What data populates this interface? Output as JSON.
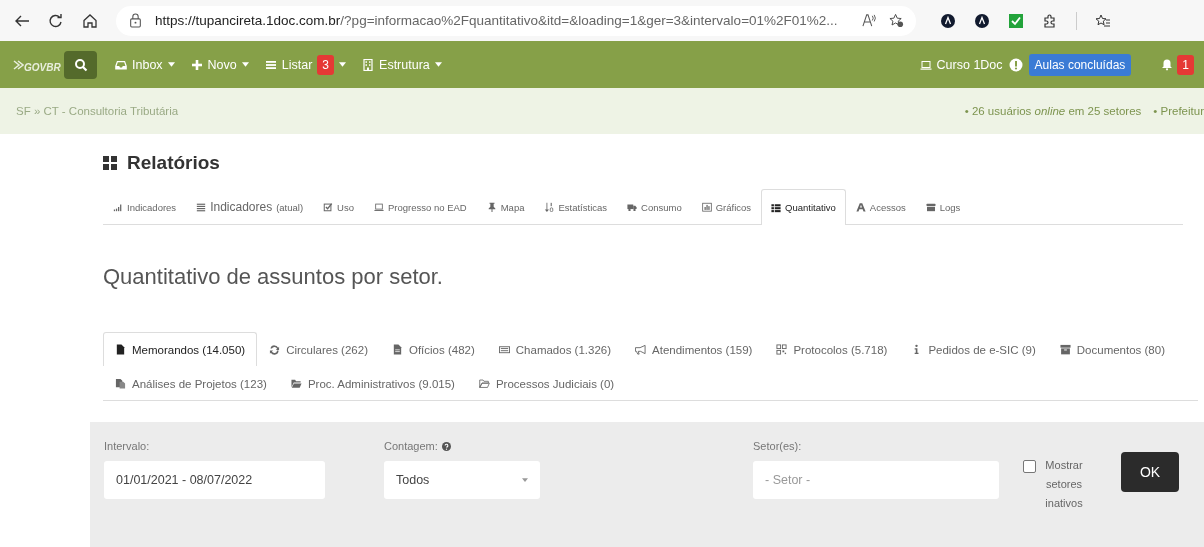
{
  "browser": {
    "url_host": "https://tupancireta.1doc.com.br",
    "url_rest": "/?pg=informacao%2Fquantitativo&itd=&loading=1&ger=3&intervalo=01%2F01%2..."
  },
  "navbar": {
    "logo": "GOVBR",
    "menu": [
      {
        "label": "Inbox"
      },
      {
        "label": "Novo"
      },
      {
        "label": "Listar",
        "badge": "3"
      },
      {
        "label": "Estrutura"
      }
    ],
    "course": "Curso 1Doc",
    "course_badge": "Aulas concluídas",
    "notifications": "1"
  },
  "breadcrumb": {
    "path": "SF » CT - Consultoria Tributária",
    "online": "• 26 usuários *online* em 25 setores",
    "org": "• Prefeitur"
  },
  "page_title": "Relatórios",
  "report_tabs": [
    {
      "label": "Indicadores",
      "selected": false
    },
    {
      "label": "Indicadores",
      "suffix": "(atual)",
      "selected": false
    },
    {
      "label": "Uso",
      "selected": false
    },
    {
      "label": "Progresso no EAD",
      "selected": false
    },
    {
      "label": "Mapa",
      "selected": false
    },
    {
      "label": "Estatísticas",
      "selected": false
    },
    {
      "label": "Consumo",
      "selected": false
    },
    {
      "label": "Gráficos",
      "selected": false
    },
    {
      "label": "Quantitativo",
      "selected": true
    },
    {
      "label": "Acessos",
      "selected": false
    },
    {
      "label": "Logs",
      "selected": false
    }
  ],
  "heading": "Quantitativo de assuntos por setor.",
  "document_tabs": [
    {
      "label": "Memorandos (14.050)",
      "selected": true
    },
    {
      "label": "Circulares (262)",
      "selected": false
    },
    {
      "label": "Ofícios (482)",
      "selected": false
    },
    {
      "label": "Chamados (1.326)",
      "selected": false
    },
    {
      "label": "Atendimentos (159)",
      "selected": false
    },
    {
      "label": "Protocolos (5.718)",
      "selected": false
    },
    {
      "label": "Pedidos de e-SIC (9)",
      "selected": false
    },
    {
      "label": "Documentos (80)",
      "selected": false
    },
    {
      "label": "Análises de Projetos (123)",
      "selected": false
    },
    {
      "label": "Proc. Administrativos (9.015)",
      "selected": false
    },
    {
      "label": "Processos Judiciais (0)",
      "selected": false
    }
  ],
  "filters": {
    "interval_label": "Intervalo:",
    "interval_value": "01/01/2021 - 08/07/2022",
    "count_label": "Contagem:",
    "count_value": "Todos",
    "sector_label": "Setor(es):",
    "sector_placeholder": "- Setor -",
    "show_inactive": {
      "label": "Mostrar setores inativos",
      "checked": false
    },
    "submit": "OK"
  }
}
